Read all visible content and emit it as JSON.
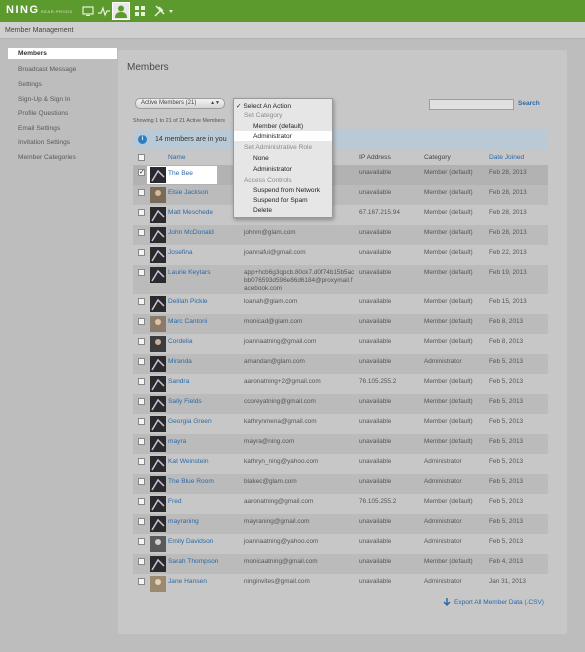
{
  "topbar": {
    "logo": "NING",
    "logo_sub": "REAR-PRODS",
    "icons": [
      "monitor-icon",
      "activity-icon",
      "user-icon",
      "grid-icon",
      "tools-icon"
    ]
  },
  "header": {
    "section_title": "Member Management"
  },
  "sidebar": {
    "items": [
      {
        "label": "Members",
        "active": true
      },
      {
        "label": "Broadcast Message"
      },
      {
        "label": "Settings"
      },
      {
        "label": "Sign-Up & Sign In"
      },
      {
        "label": "Profile Questions"
      },
      {
        "label": "Email Settings"
      },
      {
        "label": "Invitation Settings"
      },
      {
        "label": "Member Categories"
      }
    ]
  },
  "main": {
    "title": "Members",
    "filter_value": "Active Members (21)",
    "search_button": "Search",
    "showing_text": "Showing 1 to 21 of 21 Active Members",
    "info_text": "14 members are in you",
    "columns": {
      "name": "Name",
      "ip": "IP Address",
      "category": "Category",
      "date": "Date Joined"
    },
    "rows": [
      {
        "name": "The Bee",
        "email": "",
        "ip": "unavailable",
        "category": "Member (default)",
        "date": "Feb 28, 2013",
        "checked": true
      },
      {
        "name": "Elsie Jackson",
        "email": "",
        "ip": "unavailable",
        "category": "Member (default)",
        "date": "Feb 28, 2013"
      },
      {
        "name": "Matt Meschede",
        "email": "",
        "ip": "67.167.215.94",
        "category": "Member (default)",
        "date": "Feb 28, 2013"
      },
      {
        "name": "John McDonald",
        "email": "johnm@glam.com",
        "ip": "unavailable",
        "category": "Member (default)",
        "date": "Feb 28, 2013"
      },
      {
        "name": "Josefina",
        "email": "joannaful@gmail.com",
        "ip": "unavailable",
        "category": "Member (default)",
        "date": "Feb 22, 2013"
      },
      {
        "name": "Laurie Keytars",
        "email": "app+hcb6g3qpcb.80ck7.d0f74b15b5acbb076593d596e86d6184@proxymail.facebook.com",
        "ip": "unavailable",
        "category": "Member (default)",
        "date": "Feb 19, 2013"
      },
      {
        "name": "Delilah Pickle",
        "email": "loanah@glam.com",
        "ip": "unavailable",
        "category": "Member (default)",
        "date": "Feb 15, 2013"
      },
      {
        "name": "Marc Cantoni",
        "email": "monicad@glam.com",
        "ip": "unavailable",
        "category": "Member (default)",
        "date": "Feb 8, 2013"
      },
      {
        "name": "Cordelia",
        "email": "joannaatning@gmail.com",
        "ip": "unavailable",
        "category": "Member (default)",
        "date": "Feb 8, 2013"
      },
      {
        "name": "Miranda",
        "email": "amandan@glam.com",
        "ip": "unavailable",
        "category": "Administrator",
        "date": "Feb 5, 2013"
      },
      {
        "name": "Sandra",
        "email": "aaronatning+2@gmail.com",
        "ip": "76.105.255.2",
        "category": "Member (default)",
        "date": "Feb 5, 2013"
      },
      {
        "name": "Sally Fields",
        "email": "ccoreyatning@gmail.com",
        "ip": "unavailable",
        "category": "Member (default)",
        "date": "Feb 5, 2013"
      },
      {
        "name": "Georgia Green",
        "email": "kathrynmena@gmail.com",
        "ip": "unavailable",
        "category": "Member (default)",
        "date": "Feb 5, 2013"
      },
      {
        "name": "mayra",
        "email": "mayra@ning.com",
        "ip": "unavailable",
        "category": "Member (default)",
        "date": "Feb 5, 2013"
      },
      {
        "name": "Kat Weinstein",
        "email": "kathryn_ning@yahoo.com",
        "ip": "unavailable",
        "category": "Administrator",
        "date": "Feb 5, 2013"
      },
      {
        "name": "The Blue Room",
        "email": "blakec@glam.com",
        "ip": "unavailable",
        "category": "Administrator",
        "date": "Feb 5, 2013"
      },
      {
        "name": "Fred",
        "email": "aaronatning@gmail.com",
        "ip": "76.105.255.2",
        "category": "Member (default)",
        "date": "Feb 5, 2013"
      },
      {
        "name": "mayraning",
        "email": "mayraning@gmail.com",
        "ip": "unavailable",
        "category": "Administrator",
        "date": "Feb 5, 2013"
      },
      {
        "name": "Emily Davidson",
        "email": "joannaatning@yahoo.com",
        "ip": "unavailable",
        "category": "Administrator",
        "date": "Feb 5, 2013"
      },
      {
        "name": "Sarah Thompson",
        "email": "monicaatning@gmail.com",
        "ip": "unavailable",
        "category": "Member (default)",
        "date": "Feb 4, 2013"
      },
      {
        "name": "Jane Hansen",
        "email": "ninginvites@gmail.com",
        "ip": "unavailable",
        "category": "Administrator",
        "date": "Jan 31, 2013"
      }
    ],
    "export_label": "Export All Member Data (.CSV)"
  },
  "action_menu": {
    "select_action": "✓ Select An Action",
    "group_category": "Set Category",
    "member_default": "Member (default)",
    "administrator": "Administrator",
    "group_admin_role": "Set Administrative Role",
    "role_none": "None",
    "role_admin": "Administrator",
    "group_access": "Access Controls",
    "suspend_network": "Suspend from Network",
    "suspend_spam": "Suspend for Spam",
    "delete": "Delete"
  }
}
